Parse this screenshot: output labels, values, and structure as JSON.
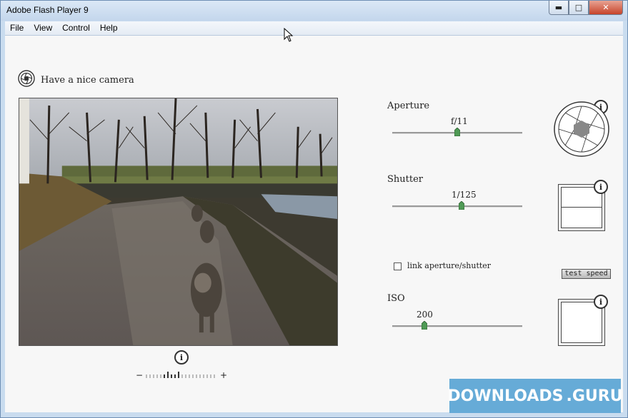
{
  "window": {
    "title": "Adobe Flash Player 9",
    "minimize": "▬",
    "maximize": "□",
    "close": "✕"
  },
  "menu": [
    "File",
    "View",
    "Control",
    "Help"
  ],
  "camera": {
    "label": "Have a nice camera",
    "info": "i"
  },
  "aperture": {
    "label": "Aperture",
    "value": "f/11",
    "slider_fraction": 0.5,
    "info": "i"
  },
  "shutter": {
    "label": "Shutter",
    "value": "1/125",
    "slider_fraction": 0.53,
    "link_label": "link aperture/shutter",
    "link_checked": false,
    "test_speed": "test speed",
    "info": "i"
  },
  "iso": {
    "label": "ISO",
    "value": "200",
    "slider_fraction": 0.25,
    "info": "i"
  },
  "exposure_meter": {
    "minus": "−",
    "plus": "+"
  },
  "watermark": {
    "text_left": "DOWNLOADS",
    "text_right": ".GURU"
  }
}
